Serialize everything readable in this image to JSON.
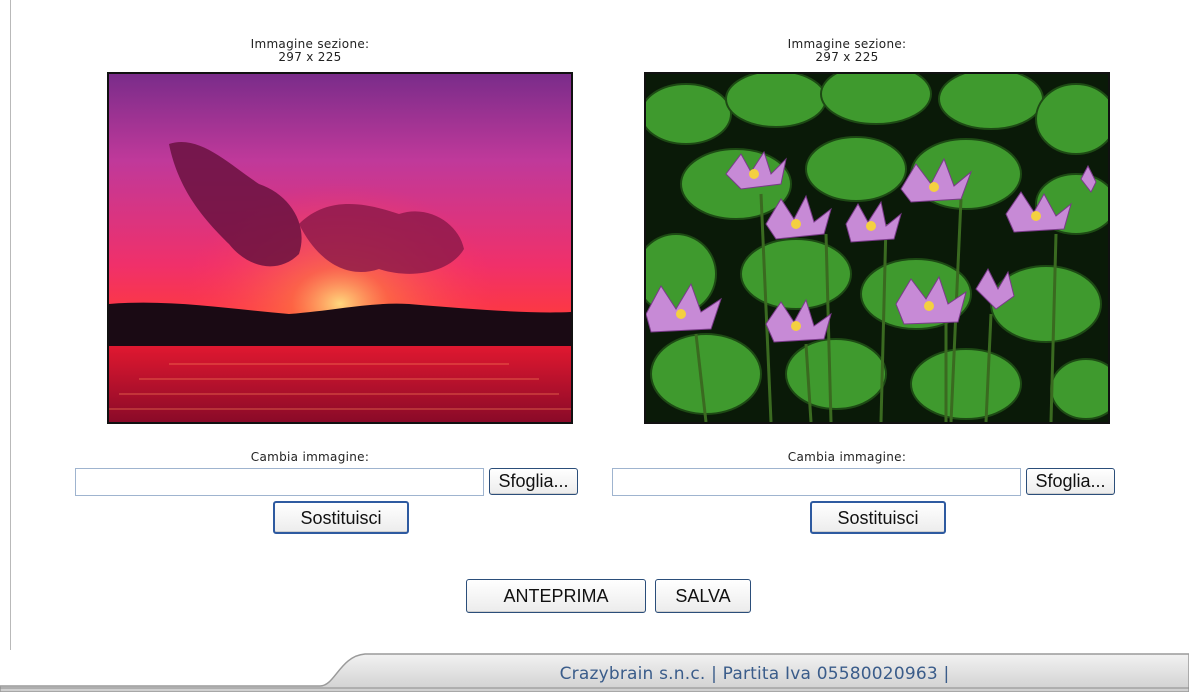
{
  "sections": [
    {
      "caption_line1": "Immagine sezione:",
      "caption_line2": "297 x 225",
      "image_alt": "sunset over water",
      "change_label": "Cambia immagine:",
      "file_value": "",
      "browse_label": "Sfoglia...",
      "replace_label": "Sostituisci"
    },
    {
      "caption_line1": "Immagine sezione:",
      "caption_line2": "297 x 225",
      "image_alt": "water lilies",
      "change_label": "Cambia immagine:",
      "file_value": "",
      "browse_label": "Sfoglia...",
      "replace_label": "Sostituisci"
    }
  ],
  "actions": {
    "preview_label": "ANTEPRIMA",
    "save_label": "SALVA"
  },
  "footer": {
    "text": "Crazybrain s.n.c. | Partita Iva 05580020963 |"
  },
  "colors": {
    "footer_text": "#3a5c8a",
    "button_border": "#2b4e7a",
    "footer_bar": "#d6d6d6"
  }
}
